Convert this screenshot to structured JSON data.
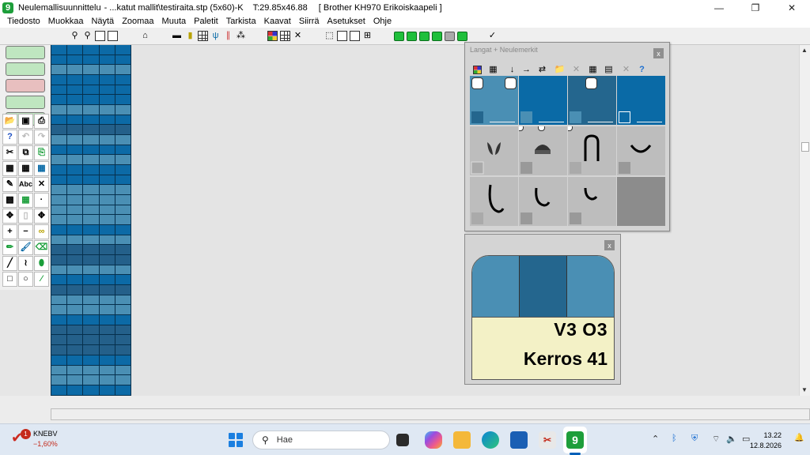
{
  "window": {
    "app_name": "Neulemallisuunnittelu",
    "file": "- ...katut mallit\\testiraita.stp (5x60)-K",
    "size": "T:29.85x46.88",
    "machine": "[ Brother KH970 Erikoiskaapeli ]",
    "buttons": {
      "minimize": "—",
      "maximize": "❐",
      "close": "✕"
    }
  },
  "menu": [
    "Tiedosto",
    "Muokkaa",
    "Näytä",
    "Zoomaa",
    "Muuta",
    "Paletit",
    "Tarkista",
    "Kaavat",
    "Siirrä",
    "Asetukset",
    "Ohje"
  ],
  "yarns_panel": {
    "title": "Langat + Neulemerkit",
    "close": "x",
    "yarn_colors": [
      "#4a8fb4",
      "#0a6aa6",
      "#24668e",
      "#0a6aa6"
    ],
    "stitch_symbols": [
      "tuck-icon",
      "knit-purl-icon",
      "cable-arch-icon",
      "curve-icon",
      "hook-left-icon",
      "hook-small-icon",
      "hook-tiny-icon"
    ]
  },
  "preview_panel": {
    "close": "x",
    "colors": [
      "#4a8fb4",
      "#24668e",
      "#4a8fb4"
    ],
    "line1": "V3 O3",
    "line2": "Kerros 41"
  },
  "grid": {
    "columns": 5,
    "rows": 35,
    "colors": {
      "light": "#4a8fb4",
      "medium": "#0c6aa6",
      "dark": "#24608a"
    }
  },
  "taskbar": {
    "stock_badge": "1",
    "stock_name": "KNEBV",
    "stock_change": "−1,60%",
    "search_placeholder": "Hae",
    "time": "13.22",
    "date": "12.8.2026"
  }
}
